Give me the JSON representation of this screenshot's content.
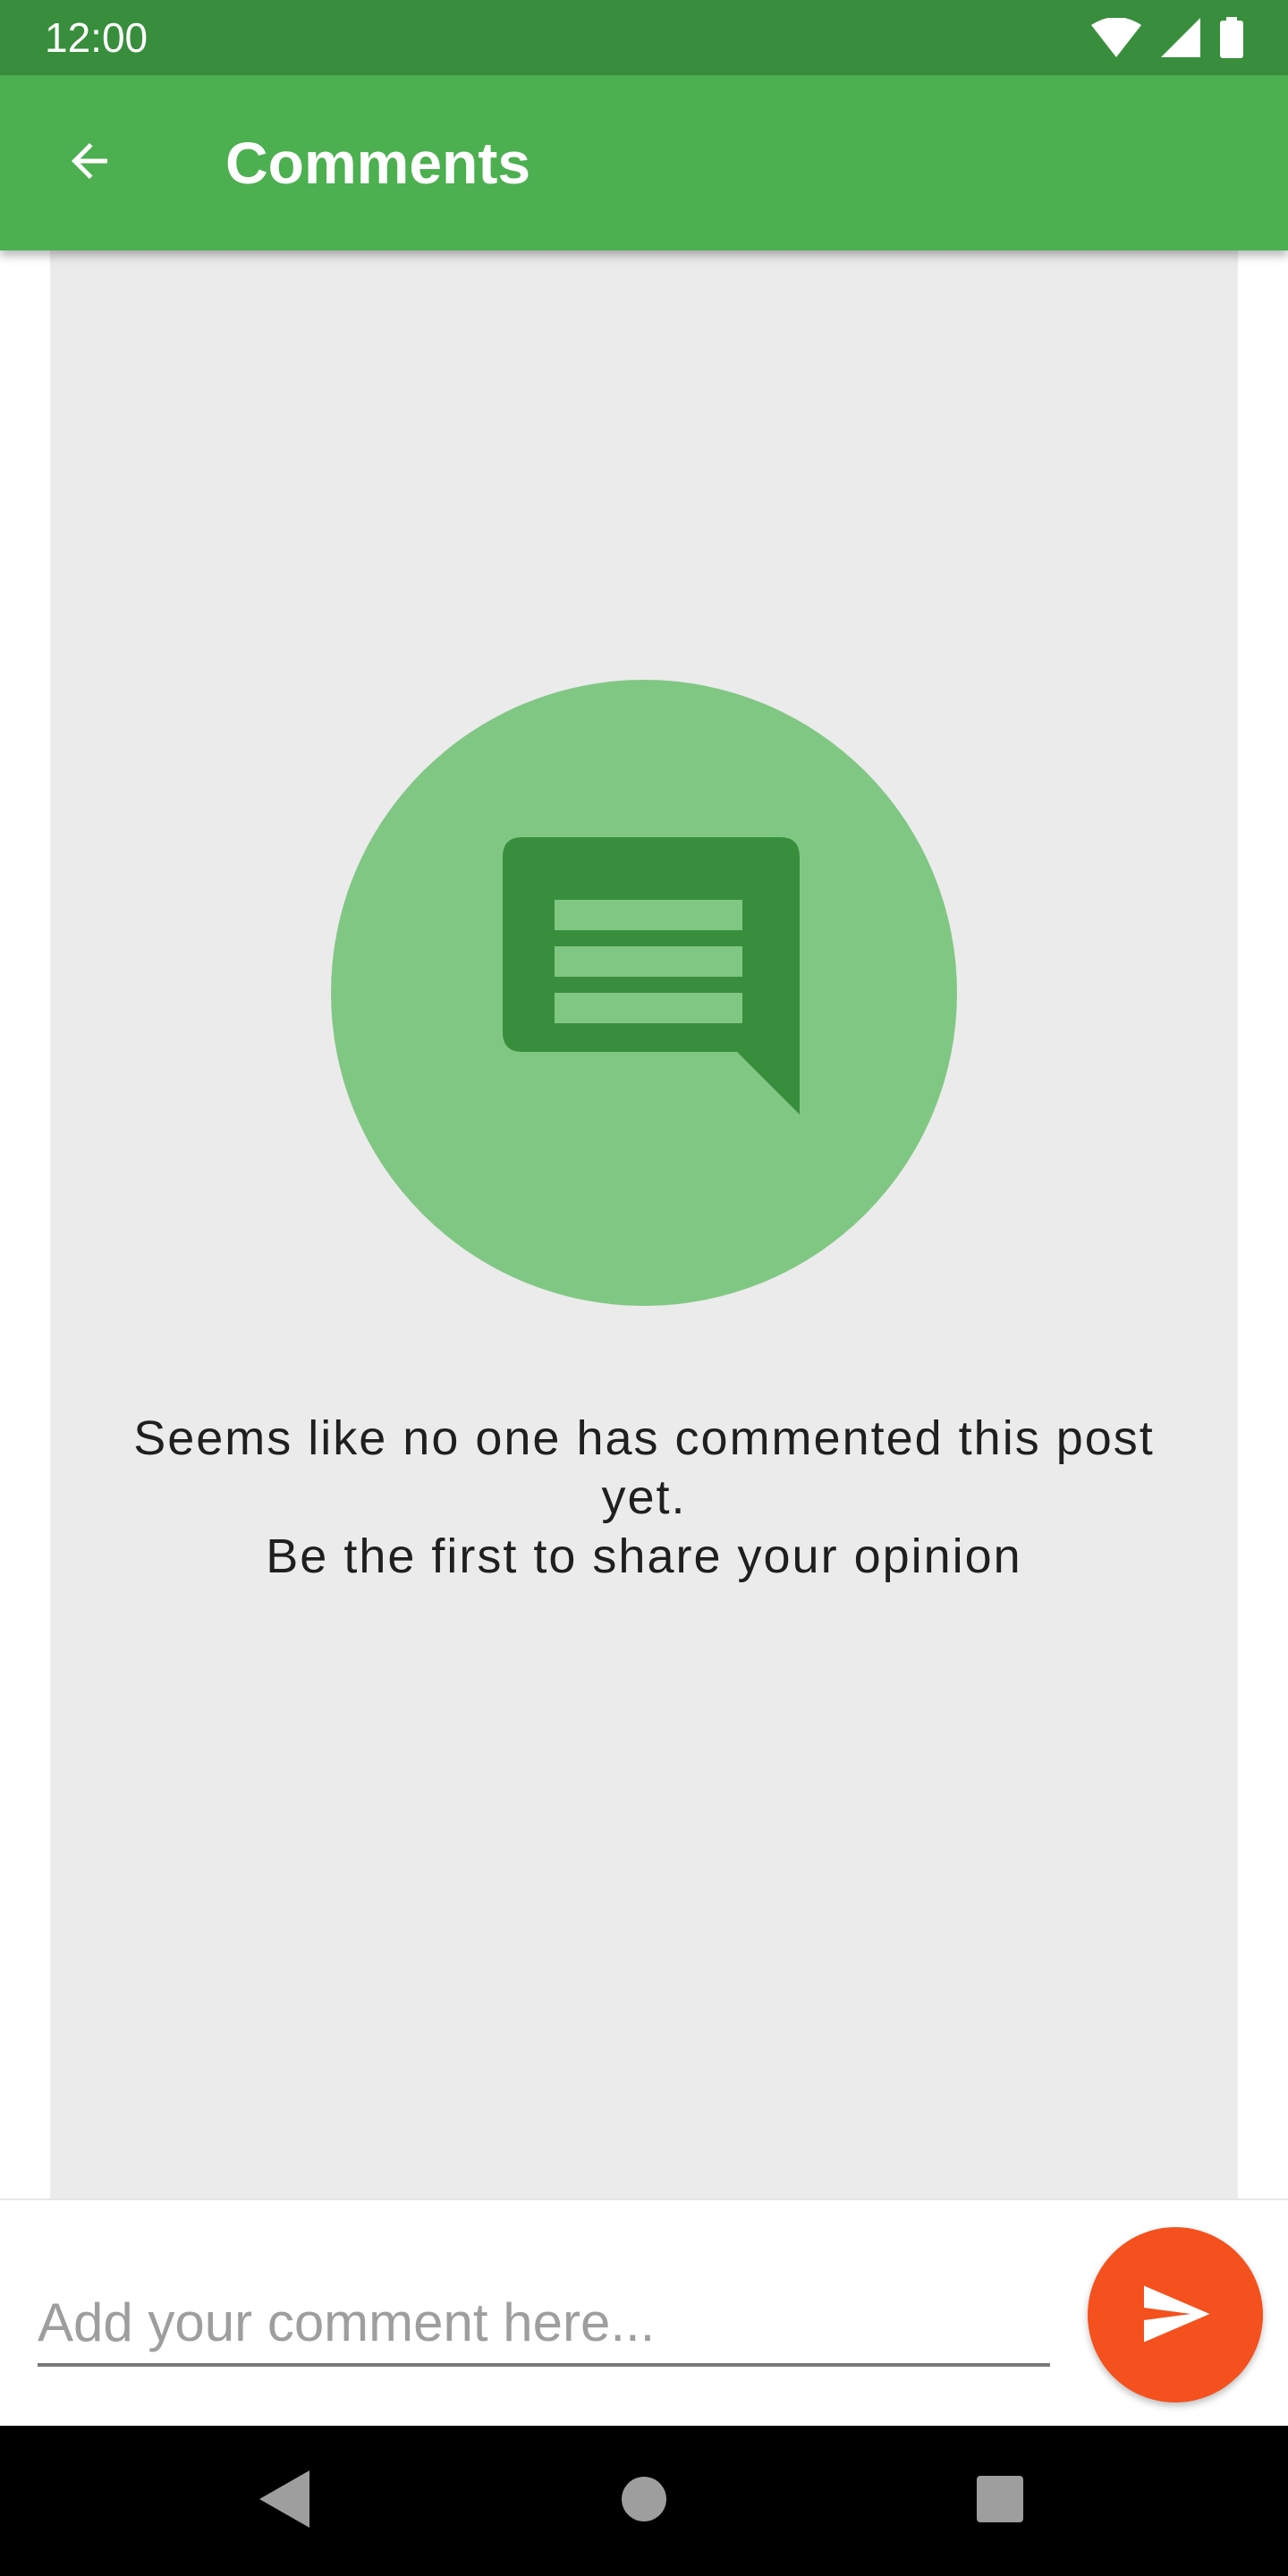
{
  "status_bar": {
    "time": "12:00",
    "icons": [
      "wifi-icon",
      "signal-icon",
      "battery-icon"
    ]
  },
  "app_bar": {
    "title": "Comments",
    "back_icon": "arrow-back-icon"
  },
  "empty_state": {
    "icon": "comment-bubble-icon",
    "line1": "Seems like no one has commented this post",
    "line2": "yet.",
    "line3": "Be the first to share your opinion"
  },
  "comment_bar": {
    "placeholder": "Add your comment here...",
    "value": "",
    "send_icon": "send-icon"
  },
  "nav_bar": {
    "icons": [
      "nav-back-icon",
      "nav-home-icon",
      "nav-recents-icon"
    ]
  },
  "colors": {
    "status_bar": "#388E3C",
    "app_bar": "#4CAF50",
    "illustration_circle": "#81C784",
    "bubble": "#388E3C",
    "panel": "#EBEBEB",
    "send_button": "#F4511E"
  }
}
